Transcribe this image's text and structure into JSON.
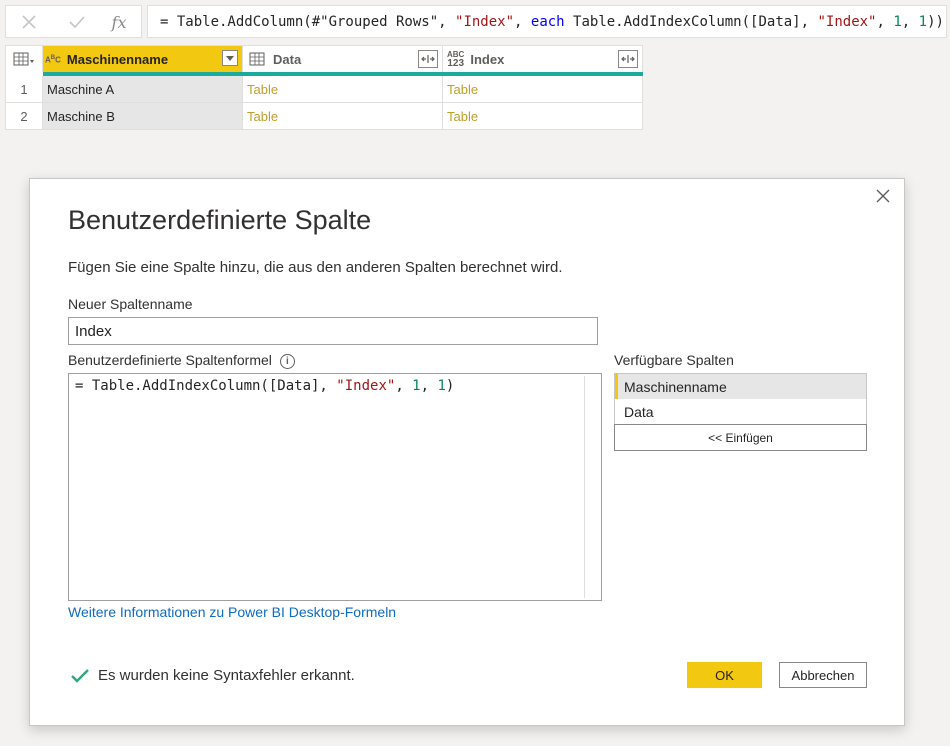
{
  "formula_bar": {
    "cancel_icon": "x-icon",
    "commit_icon": "check-icon",
    "fx_label": "fx",
    "formula_parts": {
      "p1": "= Table.AddColumn(#\"Grouped Rows\", ",
      "p2": "\"Index\"",
      "p3": ", ",
      "p4": "each",
      "p5": " Table.AddIndexColumn([Data], ",
      "p6": "\"Index\"",
      "p7": ", ",
      "p8": "1",
      "p9": ", ",
      "p10": "1",
      "p11": "))"
    }
  },
  "grid": {
    "type_abc": "ABC",
    "type_123": "123",
    "headers": {
      "col1": "Maschinenname",
      "col2": "Data",
      "col3": "Index"
    },
    "rows": [
      {
        "num": "1",
        "name": "Maschine A",
        "data": "Table",
        "index": "Table"
      },
      {
        "num": "2",
        "name": "Maschine B",
        "data": "Table",
        "index": "Table"
      }
    ],
    "quality_color": "#1aab9c",
    "accent": "#f2c811"
  },
  "dialog": {
    "title": "Benutzerdefinierte Spalte",
    "description": "Fügen Sie eine Spalte hinzu, die aus den anderen Spalten berechnet wird.",
    "name_label": "Neuer Spaltenname",
    "name_value": "Index",
    "formula_label": "Benutzerdefinierte Spaltenformel",
    "info_icon": "i",
    "formula": {
      "p1": "= Table.AddIndexColumn([Data], ",
      "p2": "\"Index\"",
      "p3": ", ",
      "p4": "1",
      "p5": ", ",
      "p6": "1",
      "p7": ")"
    },
    "available_label": "Verfügbare Spalten",
    "available_columns": [
      "Maschinenname",
      "Data"
    ],
    "insert_button": "<< Einfügen",
    "link": "Weitere Informationen zu Power BI Desktop-Formeln",
    "status": "Es wurden keine Syntaxfehler erkannt.",
    "ok_button": "OK",
    "cancel_button": "Abbrechen"
  }
}
